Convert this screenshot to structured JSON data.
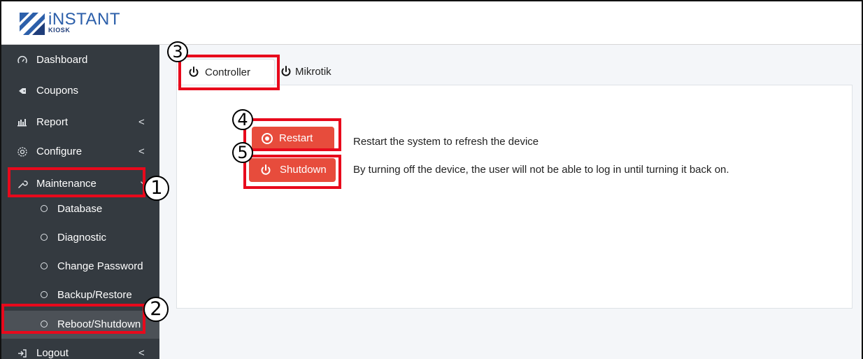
{
  "brand": {
    "name": "iNSTANT",
    "sub": "KIOSK",
    "colors": {
      "primary": "#2c5faa",
      "dark": "#1f3d7a"
    }
  },
  "sidebar": {
    "items": [
      {
        "label": "Dashboard",
        "icon": "speedometer-icon"
      },
      {
        "label": "Coupons",
        "icon": "tag-icon"
      },
      {
        "label": "Report",
        "icon": "bar-chart-icon",
        "chevron": "<"
      },
      {
        "label": "Configure",
        "icon": "gear-icon",
        "chevron": "<"
      },
      {
        "label": "Maintenance",
        "icon": "wrench-icon",
        "chevron": "⌄"
      }
    ],
    "sub_items": [
      {
        "label": "Database"
      },
      {
        "label": "Diagnostic"
      },
      {
        "label": "Change Password"
      },
      {
        "label": "Backup/Restore"
      },
      {
        "label": "Reboot/Shutdown"
      }
    ],
    "logout": {
      "label": "Logout",
      "icon": "logout-icon",
      "chevron": "<"
    }
  },
  "tabs": [
    {
      "label": "Controller",
      "icon": "power-icon",
      "active": true
    },
    {
      "label": "Mikrotik",
      "icon": "power-icon",
      "active": false
    }
  ],
  "actions": [
    {
      "label": "Restart",
      "icon": "record-icon",
      "description": "Restart the system to refresh the device"
    },
    {
      "label": "Shutdown",
      "icon": "power-icon",
      "description": "By turning off the device, the user will not be able to log in until turning it back on."
    }
  ],
  "annotations": [
    "1",
    "2",
    "3",
    "4",
    "5"
  ],
  "colors": {
    "sidebar_bg": "#343a40",
    "danger": "#e74c3c",
    "annotation_red": "#e8091c",
    "content_bg": "#f4f6f9"
  }
}
